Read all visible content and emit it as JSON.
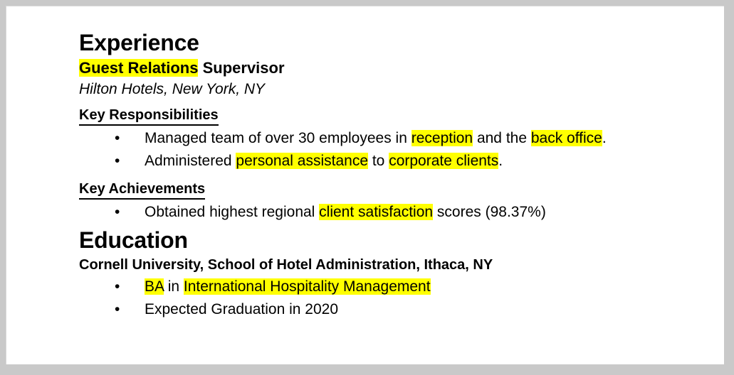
{
  "document": {
    "page_background": "#ffffff",
    "canvas_background": "#c9c9c9",
    "highlight_color": "#ffff00",
    "text_color": "#000000",
    "bullet_glyph": "•"
  },
  "sections": {
    "experience": {
      "heading": "Experience",
      "job_title": {
        "highlighted": "Guest Relations",
        "plain": " Supervisor"
      },
      "employer": "Hilton Hotels, New York, NY",
      "responsibilities": {
        "heading": "Key Responsibilities",
        "items": [
          {
            "part1": "Managed team of over 30 employees in ",
            "hl1": "reception",
            "part2": " and the ",
            "hl2": "back office",
            "part3": "."
          },
          {
            "part1": "Administered ",
            "hl1": "personal assistance",
            "part2": " to ",
            "hl2": "corporate clients",
            "part3": "."
          }
        ]
      },
      "achievements": {
        "heading": "Key Achievements",
        "items": [
          {
            "part1": "Obtained highest regional ",
            "hl1": "client satisfaction",
            "part2": " scores (98.37%)",
            "hl2": "",
            "part3": ""
          }
        ]
      }
    },
    "education": {
      "heading": "Education",
      "school": "Cornell University, School of Hotel Administration, Ithaca, NY",
      "items": [
        {
          "part1": "",
          "hl1": "BA",
          "part2": " in ",
          "hl2": "International Hospitality Management",
          "part3": ""
        },
        {
          "part1": "Expected Graduation in 2020",
          "hl1": "",
          "part2": "",
          "hl2": "",
          "part3": ""
        }
      ]
    }
  }
}
